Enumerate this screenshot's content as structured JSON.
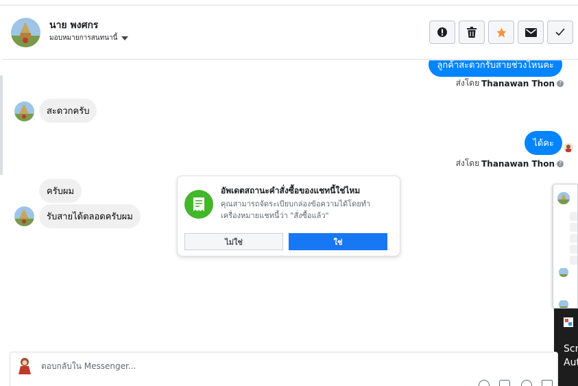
{
  "header": {
    "name": "นาย พงศกร",
    "assign_label": "มอบหมายการสนทนานี้",
    "actions": [
      {
        "icon": "alert-icon",
        "label": "mark-spam"
      },
      {
        "icon": "trash-icon",
        "label": "delete"
      },
      {
        "icon": "star-icon",
        "label": "star"
      },
      {
        "icon": "envelope-icon",
        "label": "mark-unread"
      },
      {
        "icon": "check-icon",
        "label": "mark-done"
      }
    ]
  },
  "messages": {
    "m1_text": "ลูกค้าสะดวกรับสายช่วงไหนคะ",
    "m1_sent_prefix": "ส่งโดย",
    "m1_sent_name": "Thanawan Thon",
    "m2_text": "สะดวกครับ",
    "m3_text": "ได้คะ",
    "m3_sent_prefix": "ส่งโดย",
    "m3_sent_name": "Thanawan Thon",
    "m4_text": "ครับผม",
    "m5_text": "รับสายได้ตลอดครับผม"
  },
  "order_prompt": {
    "title": "อัพเดตสถานะคำสั่งซื้อของแชทนี้ใช่ไหม",
    "description": "คุณสามารถจัดระเบียบกล่องข้อความได้โดยทำเครื่องหมายแชทนี้ว่า \"สั่งซื้อแล้ว\"",
    "no_label": "ไม่ใช่",
    "yes_label": "ใช่"
  },
  "side_overlay": {
    "line1": "Scre",
    "line2": "Aut"
  },
  "reply": {
    "placeholder": "ตอบกลับใน Messenger..."
  },
  "colors": {
    "messenger_blue": "#0084ff",
    "button_blue": "#1877f2",
    "star_orange": "#f7923a",
    "order_green": "#42b72a"
  }
}
